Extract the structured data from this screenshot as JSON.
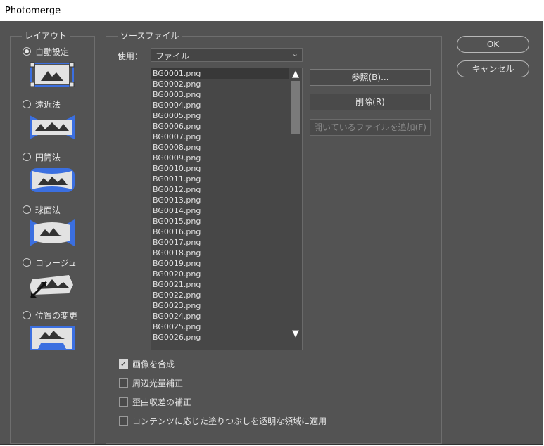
{
  "window": {
    "title": "Photomerge"
  },
  "layout": {
    "legend": "レイアウト",
    "options": [
      {
        "label": "自動設定",
        "selected": true,
        "icon": "auto-layout-icon"
      },
      {
        "label": "遠近法",
        "selected": false,
        "icon": "perspective-layout-icon"
      },
      {
        "label": "円筒法",
        "selected": false,
        "icon": "cylindrical-layout-icon"
      },
      {
        "label": "球面法",
        "selected": false,
        "icon": "spherical-layout-icon"
      },
      {
        "label": "コラージュ",
        "selected": false,
        "icon": "collage-layout-icon"
      },
      {
        "label": "位置の変更",
        "selected": false,
        "icon": "reposition-layout-icon"
      }
    ]
  },
  "source": {
    "legend": "ソースファイル",
    "use_label": "使用：",
    "use_value": "ファイル",
    "files": [
      "BG0001.png",
      "BG0002.png",
      "BG0003.png",
      "BG0004.png",
      "BG0005.png",
      "BG0006.png",
      "BG0007.png",
      "BG0008.png",
      "BG0009.png",
      "BG0010.png",
      "BG0011.png",
      "BG0012.png",
      "BG0013.png",
      "BG0014.png",
      "BG0015.png",
      "BG0016.png",
      "BG0017.png",
      "BG0018.png",
      "BG0019.png",
      "BG0020.png",
      "BG0021.png",
      "BG0022.png",
      "BG0023.png",
      "BG0024.png",
      "BG0025.png",
      "BG0026.png"
    ],
    "browse_label": "参照(B)...",
    "remove_label": "削除(R)",
    "add_open_label": "開いているファイルを追加(F)"
  },
  "options": {
    "blend": {
      "label": "画像を合成",
      "checked": true
    },
    "vignette": {
      "label": "周辺光量補正",
      "checked": false
    },
    "distortion": {
      "label": "歪曲収差の補正",
      "checked": false
    },
    "content_aware": {
      "label": "コンテンツに応じた塗りつぶしを透明な領域に適用",
      "checked": false
    }
  },
  "actions": {
    "ok_label": "OK",
    "cancel_label": "キャンセル"
  },
  "colors": {
    "accent_blue": "#3b6fe0",
    "thumb_gray": "#e2e2e2"
  }
}
